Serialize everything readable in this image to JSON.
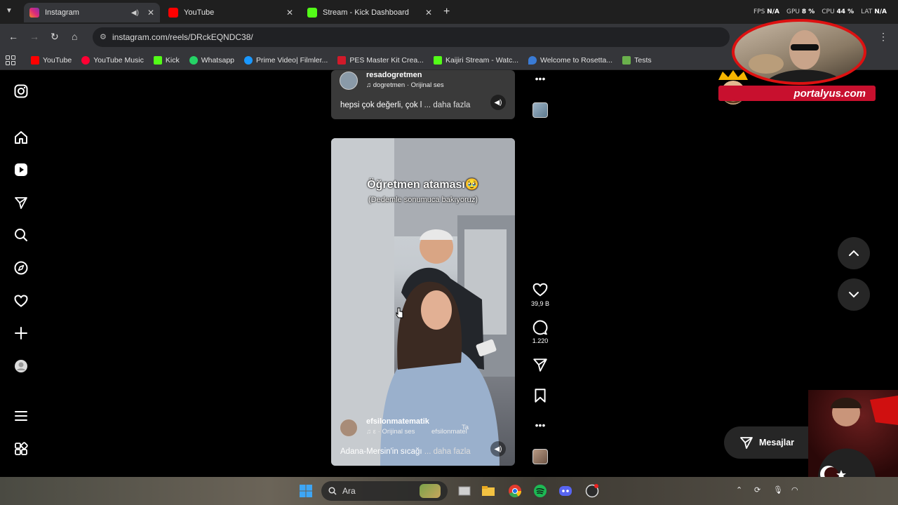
{
  "browser": {
    "tabs": [
      {
        "title": "Instagram",
        "color": "#e1306c",
        "active": true
      },
      {
        "title": "YouTube",
        "color": "#ff0000",
        "active": false
      },
      {
        "title": "Stream - Kick Dashboard",
        "color": "#53fc18",
        "active": false
      }
    ],
    "hud": {
      "fps_label": "FPS",
      "fps_value": "N/A",
      "gpu_label": "GPU",
      "gpu_value": "8 %",
      "cpu_label": "CPU",
      "cpu_value": "44 %",
      "lat_label": "LAT",
      "lat_value": "N/A"
    },
    "url": "instagram.com/reels/DRckEQNDC38/",
    "bookmarks": [
      {
        "label": "YouTube",
        "color": "#ff0000"
      },
      {
        "label": "YouTube Music",
        "color": "#ff0033"
      },
      {
        "label": "Kick",
        "color": "#53fc18"
      },
      {
        "label": "Whatsapp",
        "color": "#25d366"
      },
      {
        "label": "Prime Video| Filmler...",
        "color": "#1a98ff"
      },
      {
        "label": "PES Master Kit Crea...",
        "color": "#d11a2a"
      },
      {
        "label": "Kaijiri Stream - Watc...",
        "color": "#53fc18"
      },
      {
        "label": "Welcome to Rosetta...",
        "color": "#3a7bd5"
      },
      {
        "label": "Tests",
        "color": "#6ab04c"
      }
    ]
  },
  "sidebar": {
    "icons": [
      "instagram-logo-icon",
      "home-icon",
      "reels-icon",
      "messages-icon",
      "search-icon",
      "explore-icon",
      "heart-icon",
      "create-icon",
      "profile-icon",
      "menu-icon",
      "apps-icon"
    ]
  },
  "reel_top": {
    "username": "resadogretmen",
    "audio": "dogretmen · Orijinal ses",
    "caption": "hepsi çok değerli, çok l",
    "more": "... daha fazla"
  },
  "reel_main": {
    "overlay_title": "Öğretmen ataması🥹",
    "overlay_subtitle": "(Dedemle sonumuca bakıyoruz)",
    "username": "efsilonmatematik",
    "audio": "ε · Orijinal ses",
    "watermark_small": "efsilonmatel",
    "watermark_top": "Ta",
    "caption": "Adana-Mersin'in sıcağı",
    "more": "... daha fazla",
    "likes": "39,9 B",
    "comments": "1.220"
  },
  "messages": {
    "label": "Mesajlar"
  },
  "overlay": {
    "brand": "portalyus.com"
  },
  "taskbar": {
    "search_placeholder": "Ara"
  }
}
